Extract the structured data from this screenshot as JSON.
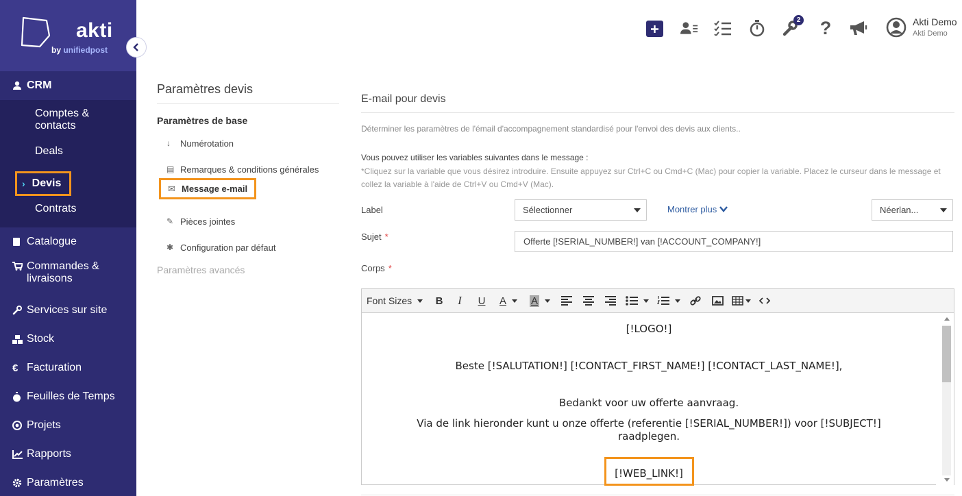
{
  "brand": {
    "name": "akti",
    "by": "by ",
    "partner": "unifiedpost"
  },
  "sidebar": {
    "items": [
      {
        "label": "CRM",
        "icon": "user-icon"
      },
      {
        "label": "Catalogue",
        "icon": "book-icon"
      },
      {
        "label": "Commandes &\nlivraisons",
        "icon": "cart-icon"
      },
      {
        "label": "Services sur site",
        "icon": "wrench-icon"
      },
      {
        "label": "Stock",
        "icon": "boxes-icon"
      },
      {
        "label": "Facturation",
        "icon": "euro-icon"
      },
      {
        "label": "Feuilles de Temps",
        "icon": "stopwatch-icon"
      },
      {
        "label": "Projets",
        "icon": "target-icon"
      },
      {
        "label": "Rapports",
        "icon": "chart-icon"
      },
      {
        "label": "Paramètres",
        "icon": "gear-icon"
      }
    ],
    "crm_sub": [
      {
        "label": "Comptes &\ncontacts"
      },
      {
        "label": "Deals"
      },
      {
        "label": "Devis"
      },
      {
        "label": "Contrats"
      }
    ]
  },
  "header": {
    "notification_count": "2",
    "user_name": "Akti Demo",
    "user_company": "Akti Demo"
  },
  "settings": {
    "title": "Paramètres devis",
    "section_basic": "Paramètres de base",
    "items": [
      {
        "label": "Numérotation",
        "icon": "sort-icon"
      },
      {
        "label": "Remarques & conditions générales",
        "icon": "document-icon"
      },
      {
        "label": "Message e-mail",
        "icon": "envelope-icon"
      },
      {
        "label": "Pièces jointes",
        "icon": "paperclip-icon"
      },
      {
        "label": "Configuration par défaut",
        "icon": "gear-icon"
      }
    ],
    "section_advanced": "Paramètres avancés"
  },
  "content": {
    "title": "E-mail pour devis",
    "description": "Déterminer les paramètres de l'émail d'accompagnement standardisé pour l'envoi des devis aux clients..",
    "vars_title": "Vous pouvez utiliser les variables suivantes dans le message :",
    "vars_note": "*Cliquez sur la variable que vous désirez introduire. Ensuite appuyez sur Ctrl+C ou Cmd+C (Mac) pour copier la variable. Placez le curseur dans le message et collez la variable à l'aide de Ctrl+V ou Cmd+V (Mac).",
    "label_label": "Label",
    "label_select": "Sélectionner",
    "show_more": "Montrer plus",
    "language_select": "Néerlan...",
    "subject_label": "Sujet",
    "subject_value": "Offerte  [!SERIAL_NUMBER!] van [!ACCOUNT_COMPANY!]",
    "body_label": "Corps",
    "required_mark": "*"
  },
  "editor": {
    "font_sizes": "Font Sizes",
    "lines": {
      "logo": "[!LOGO!]",
      "greeting": "Beste [!SALUTATION!] [!CONTACT_FIRST_NAME!] [!CONTACT_LAST_NAME!],",
      "thanks": "Bedankt voor uw offerte aanvraag.",
      "link_intro": "Via de link hieronder kunt u onze offerte (referentie [!SERIAL_NUMBER!]) voor [!SUBJECT!] raadplegen.",
      "web_link": "[!WEB_LINK!]"
    }
  },
  "colors": {
    "sidebar_bg": "#2e2c72",
    "highlight": "#f3941d",
    "accent": "#2e2c72",
    "link": "#2c5aa0"
  }
}
